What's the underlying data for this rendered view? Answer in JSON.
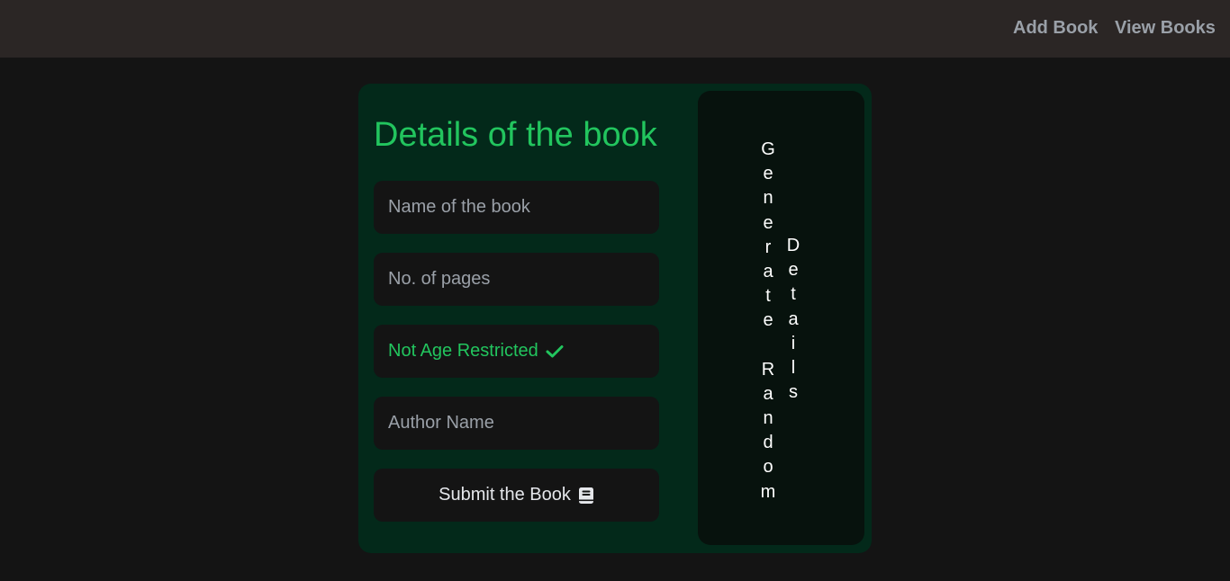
{
  "nav": {
    "add_book": "Add Book",
    "view_books": "View Books"
  },
  "form": {
    "title": "Details of the book",
    "name_placeholder": "Name of the book",
    "pages_placeholder": "No. of pages",
    "age_toggle_label": "Not Age Restricted",
    "author_placeholder": "Author Name",
    "submit_label": "Submit the Book",
    "submit_icon": "book-icon",
    "toggle_icon": "check-icon"
  },
  "generate": {
    "word1": "Generate Random",
    "word2": "Details",
    "col1_letters": [
      "G",
      "e",
      "n",
      "e",
      "r",
      "a",
      "t",
      "e",
      "",
      "R",
      "a",
      "n",
      "d",
      "o",
      "m"
    ],
    "col2_letters": [
      "D",
      "e",
      "t",
      "a",
      "i",
      "l",
      "s"
    ]
  },
  "colors": {
    "accent": "#22c55e",
    "card_bg": "#03291a",
    "page_bg": "#141414",
    "navbar_bg": "#2b2625"
  }
}
